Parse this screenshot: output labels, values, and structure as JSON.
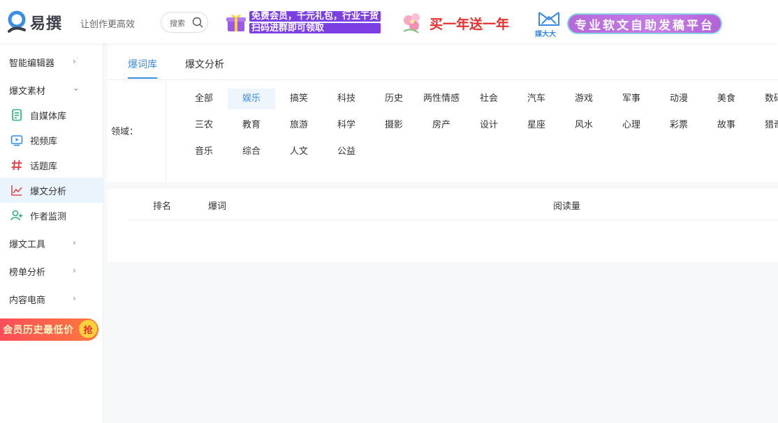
{
  "header": {
    "logo_text": "易撰",
    "slogan": "让创作更高效",
    "search_placeholder": "搜索",
    "banner1_line1": "免费会员，千元礼包，行业干货",
    "banner1_line2": "扫码进群即可领取",
    "banner2_text": "买一年送一年",
    "banner3_brand": "媒大大",
    "banner3_text": "专业软文自助发稿平台"
  },
  "sidebar": {
    "items": [
      {
        "label": "智能编辑器"
      },
      {
        "label": "爆文素材"
      },
      {
        "label": "自媒体库",
        "icon": "document-icon"
      },
      {
        "label": "视频库",
        "icon": "video-icon"
      },
      {
        "label": "话题库",
        "icon": "hashtag-icon"
      },
      {
        "label": "爆文分析",
        "icon": "line-chart-icon",
        "active": true
      },
      {
        "label": "作者监测",
        "icon": "add-user-icon"
      },
      {
        "label": "爆文工具"
      },
      {
        "label": "榜单分析"
      },
      {
        "label": "内容电商"
      }
    ],
    "promo_text": "会员历史最低价",
    "promo_badge": "抢"
  },
  "tabs": [
    {
      "label": "爆词库",
      "active": true
    },
    {
      "label": "爆文分析",
      "active": false
    }
  ],
  "filter": {
    "label": "领域：",
    "categories": [
      "全部",
      "娱乐",
      "搞笑",
      "科技",
      "历史",
      "两性情感",
      "社会",
      "汽车",
      "游戏",
      "军事",
      "动漫",
      "美食",
      "数码",
      "三农",
      "教育",
      "旅游",
      "科学",
      "摄影",
      "房产",
      "设计",
      "星座",
      "风水",
      "心理",
      "彩票",
      "故事",
      "猎奇",
      "音乐",
      "综合",
      "人文",
      "公益"
    ],
    "selected": "娱乐"
  },
  "table": {
    "columns": [
      "排名",
      "爆词",
      "阅读量"
    ]
  },
  "colors": {
    "accent": "#3a8ee6",
    "active_bg": "#e9f4fd",
    "hashtag": "#e5474b"
  }
}
